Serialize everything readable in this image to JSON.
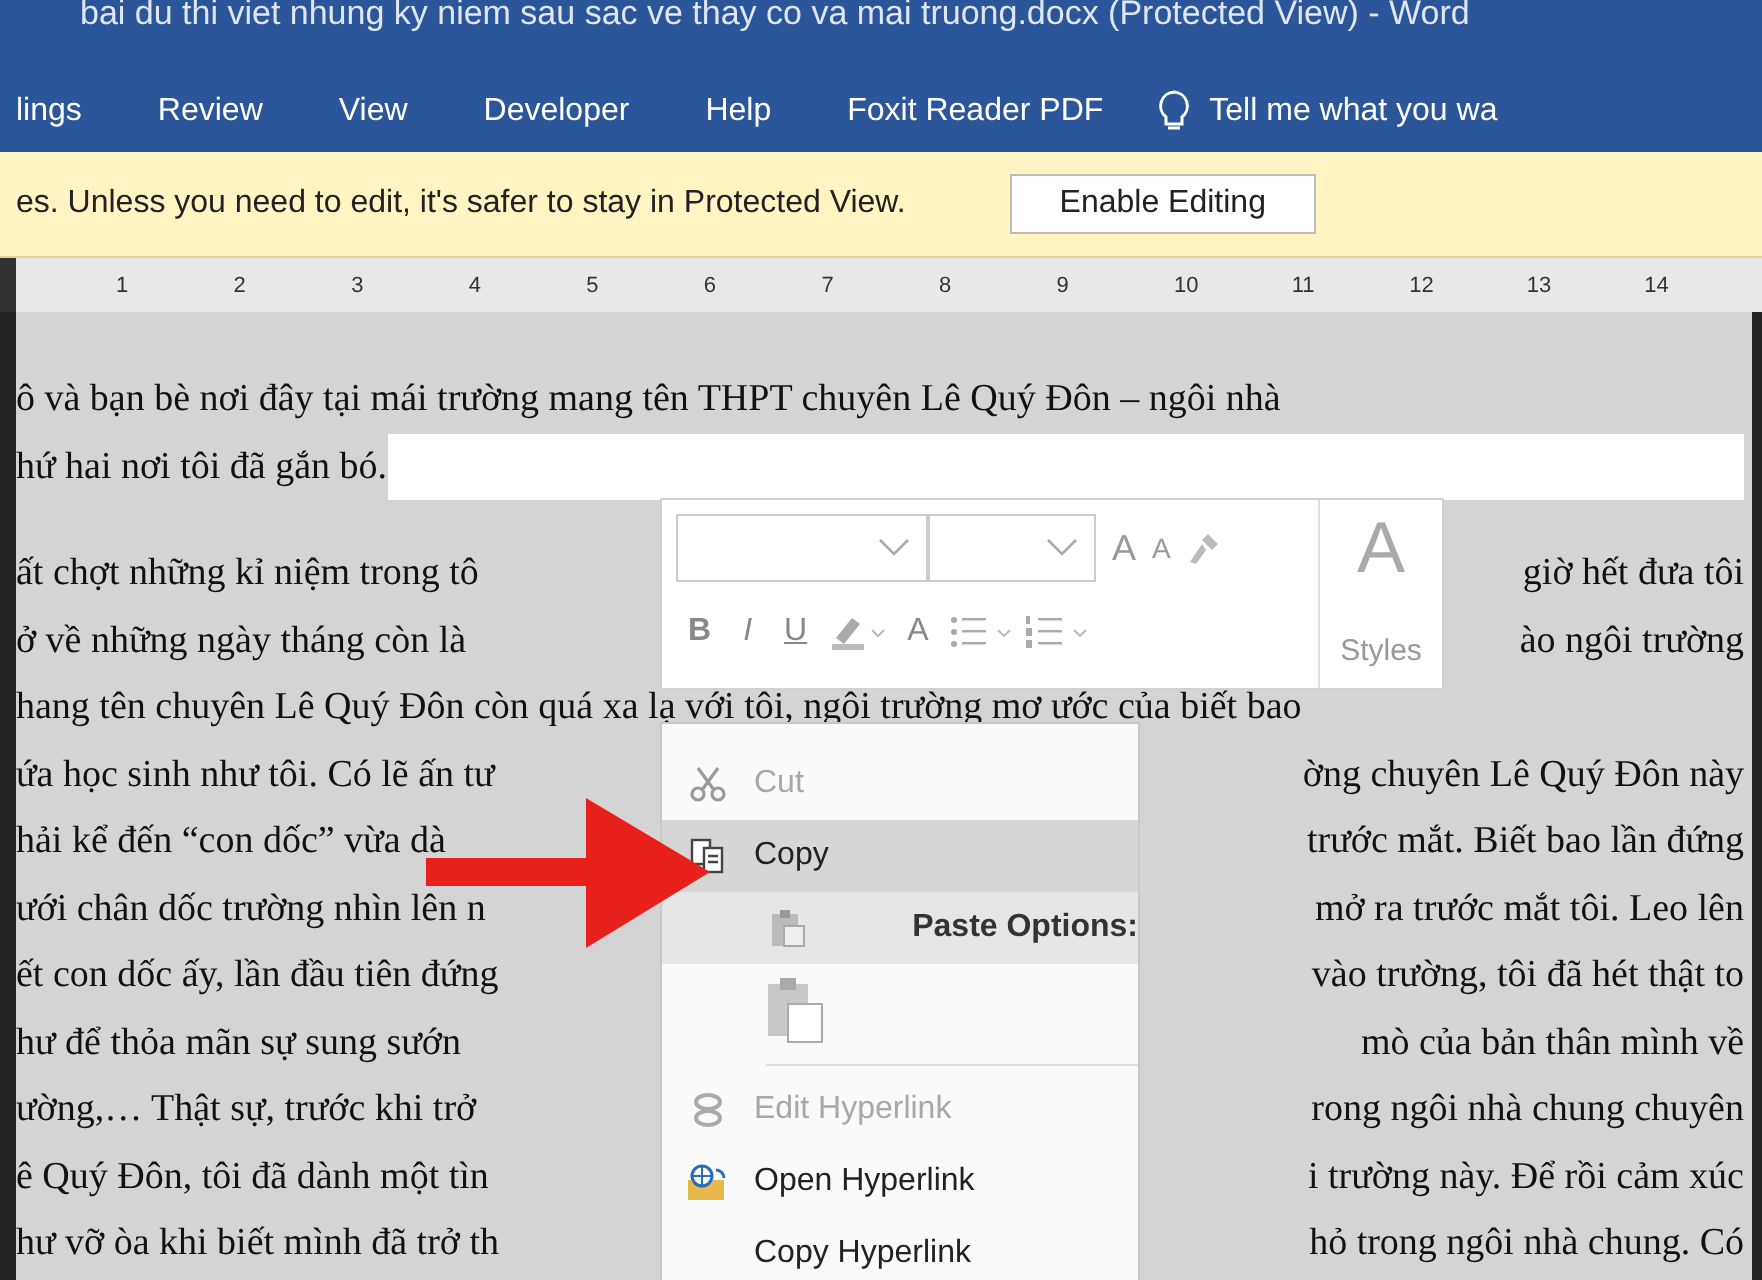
{
  "window": {
    "title": "bai du thi viet nhung ky niem sau sac ve thay co va mai truong.docx (Protected View) - Word"
  },
  "ribbon_tabs": [
    {
      "label": "lings"
    },
    {
      "label": "Review"
    },
    {
      "label": "View"
    },
    {
      "label": "Developer"
    },
    {
      "label": "Help"
    },
    {
      "label": "Foxit Reader PDF"
    }
  ],
  "tell_me": {
    "placeholder": "Tell me what you wa"
  },
  "message_bar": {
    "text": "es. Unless you need to edit, it's safer to stay in Protected View.",
    "button": "Enable Editing"
  },
  "ruler": {
    "marks": [
      "1",
      "2",
      "3",
      "4",
      "5",
      "6",
      "7",
      "8",
      "9",
      "10",
      "11",
      "12",
      "13",
      "14"
    ]
  },
  "document": {
    "paragraphs": [
      {
        "lines": [
          {
            "left": "ô và bạn bè nơi đây tại mái trường mang tên THPT chuyên Lê Quý Đôn – ngôi nhà"
          },
          {
            "left": "hứ hai nơi tôi đã gắn bó."
          }
        ]
      },
      {
        "lines": [
          {
            "left": "ất chợt những kỉ niệm trong tô",
            "right": "giờ hết đưa tôi"
          },
          {
            "left": "ở về những ngày tháng còn là",
            "right": "ào ngôi trường"
          },
          {
            "left": "hang tên chuyên Lê Quý Đôn còn quá xa lạ với tôi, ngôi trường mơ ước của biết bao"
          },
          {
            "left": "ứa học sinh như tôi. Có lẽ ấn tư",
            "right": "ờng chuyên Lê Quý Đôn này"
          },
          {
            "left": "hải kể đến “con dốc” vừa dà",
            "right": "trước mắt. Biết bao lần đứng"
          },
          {
            "left": "ưới chân dốc trường nhìn lên n",
            "right": "mở ra trước mắt tôi. Leo lên"
          },
          {
            "left": "ết con dốc ấy, lần đầu tiên đứng",
            "right": "vào trường, tôi đã hét thật to"
          },
          {
            "left": "hư để thỏa mãn sự sung sướn",
            "right": "mò của bản thân mình về"
          },
          {
            "left": "ường,… Thật sự, trước khi trở",
            "right": "rong ngôi nhà chung chuyên"
          },
          {
            "left": "ê Quý Đôn, tôi đã dành một tìn",
            "right": "i trường này. Để rồi cảm xúc"
          },
          {
            "left": "hư vỡ òa khi biết mình đã trở th",
            "right": "hỏ trong ngôi nhà chung. Có"
          }
        ]
      }
    ]
  },
  "mini_toolbar": {
    "grow_font": "A",
    "shrink_font": "A",
    "format_buttons": [
      "B",
      "I",
      "U"
    ],
    "font_color": "A",
    "styles_glyph": "A",
    "styles_label": "Styles"
  },
  "context_menu": {
    "items": [
      {
        "kind": "item",
        "label": "Cut",
        "disabled": true,
        "selected": false
      },
      {
        "kind": "item",
        "label": "Copy",
        "disabled": false,
        "selected": true
      },
      {
        "kind": "header",
        "label": "Paste Options:"
      },
      {
        "kind": "paste"
      },
      {
        "kind": "separator"
      },
      {
        "kind": "item",
        "label": "Edit Hyperlink",
        "disabled": true,
        "selected": false
      },
      {
        "kind": "item",
        "label": "Open Hyperlink",
        "disabled": false,
        "selected": false
      },
      {
        "kind": "item",
        "label": "Copy Hyperlink",
        "disabled": false,
        "selected": false
      }
    ]
  }
}
